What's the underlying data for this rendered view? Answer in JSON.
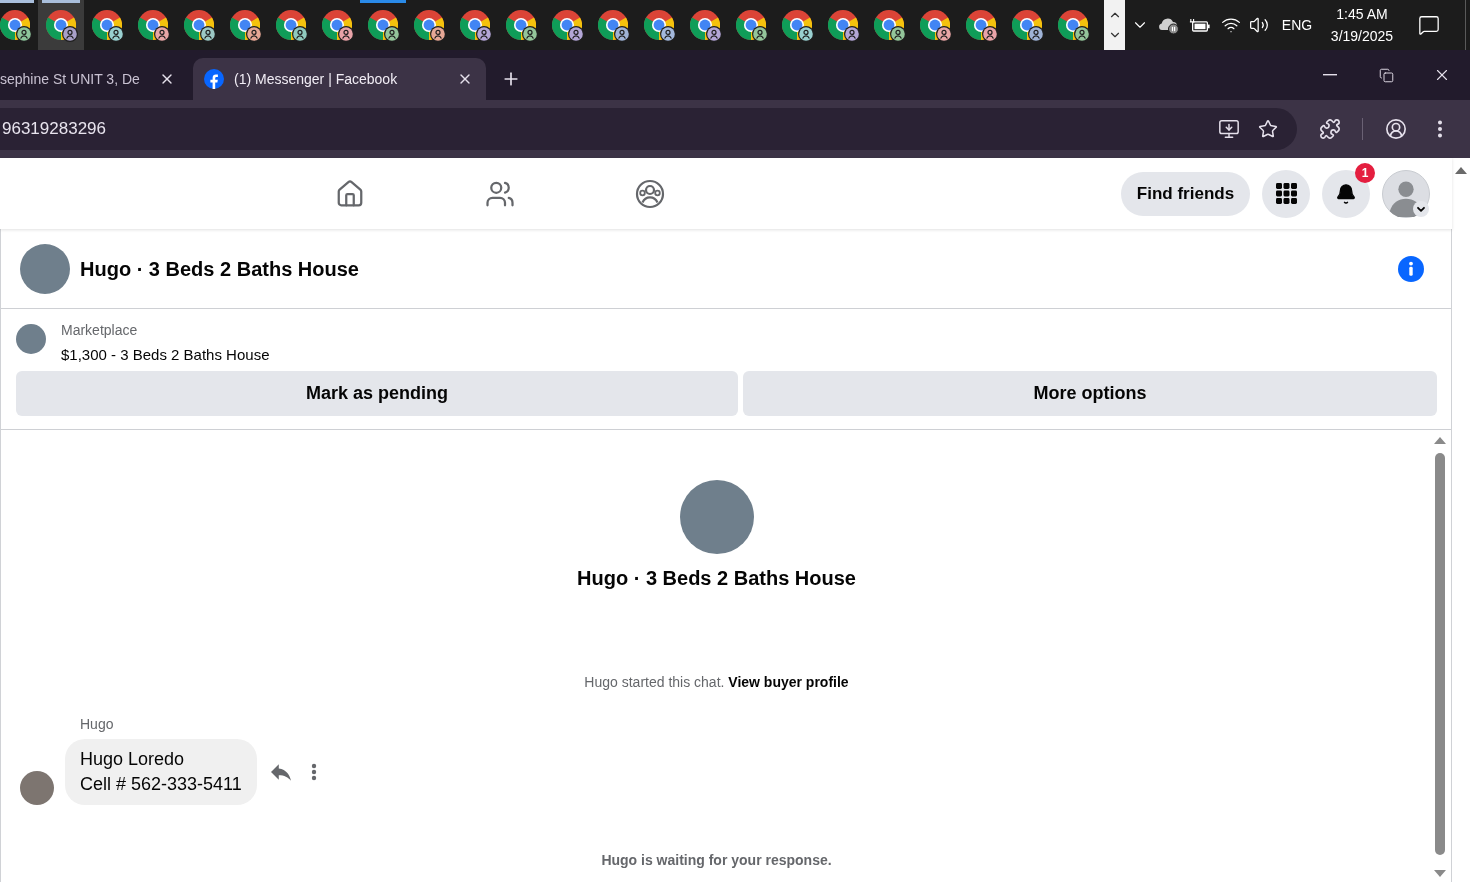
{
  "taskbar": {
    "apps": [
      {
        "color": "#8cc49a",
        "selected": false,
        "running": true,
        "active": false
      },
      {
        "color": "#a8a0c8",
        "selected": true,
        "running": true,
        "active": false
      },
      {
        "color": "#99d0d0",
        "selected": false,
        "running": false,
        "active": false
      },
      {
        "color": "#e8a6a6",
        "selected": false,
        "running": false,
        "active": false
      },
      {
        "color": "#9cc8c4",
        "selected": false,
        "running": false,
        "active": false
      },
      {
        "color": "#e6a795",
        "selected": false,
        "running": false,
        "active": false
      },
      {
        "color": "#8fc9bd",
        "selected": false,
        "running": false,
        "active": false
      },
      {
        "color": "#e9a3a8",
        "selected": false,
        "running": false,
        "active": false
      },
      {
        "color": "#93c59a",
        "selected": false,
        "running": false,
        "active": true
      },
      {
        "color": "#e6a795",
        "selected": false,
        "running": false,
        "active": false
      },
      {
        "color": "#b3a6d6",
        "selected": false,
        "running": false,
        "active": false
      },
      {
        "color": "#93c59a",
        "selected": false,
        "running": false,
        "active": false
      },
      {
        "color": "#b3a6d6",
        "selected": false,
        "running": false,
        "active": false
      },
      {
        "color": "#9fb3d6",
        "selected": false,
        "running": false,
        "active": false
      },
      {
        "color": "#a3b8dc",
        "selected": false,
        "running": false,
        "active": false
      },
      {
        "color": "#b3a6d6",
        "selected": false,
        "running": false,
        "active": false
      },
      {
        "color": "#93c59a",
        "selected": false,
        "running": false,
        "active": false
      },
      {
        "color": "#99d0d0",
        "selected": false,
        "running": false,
        "active": false
      },
      {
        "color": "#b3a6d6",
        "selected": false,
        "running": false,
        "active": false
      },
      {
        "color": "#93c59a",
        "selected": false,
        "running": false,
        "active": false
      },
      {
        "color": "#e8a6a6",
        "selected": false,
        "running": false,
        "active": false
      },
      {
        "color": "#e9a3a8",
        "selected": false,
        "running": false,
        "active": false
      },
      {
        "color": "#9fb3d6",
        "selected": false,
        "running": false,
        "active": false
      },
      {
        "color": "#93c59a",
        "selected": false,
        "running": false,
        "active": false
      }
    ],
    "tray": {
      "language": "ENG",
      "time": "1:45 AM",
      "date": "3/19/2025"
    }
  },
  "browser": {
    "tabs": [
      {
        "title": "sephine St UNIT 3, De",
        "selected": false
      },
      {
        "title": "(1) Messenger | Facebook",
        "selected": true
      }
    ],
    "address": "96319283296"
  },
  "header": {
    "find_friends": "Find friends",
    "notification_count": "1"
  },
  "chat": {
    "title": "Hugo · 3 Beds 2 Baths House",
    "listing": {
      "source": "Marketplace",
      "title": "$1,300 - 3 Beds 2 Baths House"
    },
    "actions": [
      "Mark as pending",
      "More options"
    ],
    "intro": {
      "title": "Hugo · 3 Beds 2 Baths House",
      "notice": "Hugo started this chat.",
      "link": "View buyer profile"
    },
    "messages": [
      {
        "sender": "Hugo",
        "lines": [
          "Hugo Loredo",
          "Cell # 562-333-5411"
        ]
      }
    ],
    "status": "Hugo is waiting for your response."
  }
}
